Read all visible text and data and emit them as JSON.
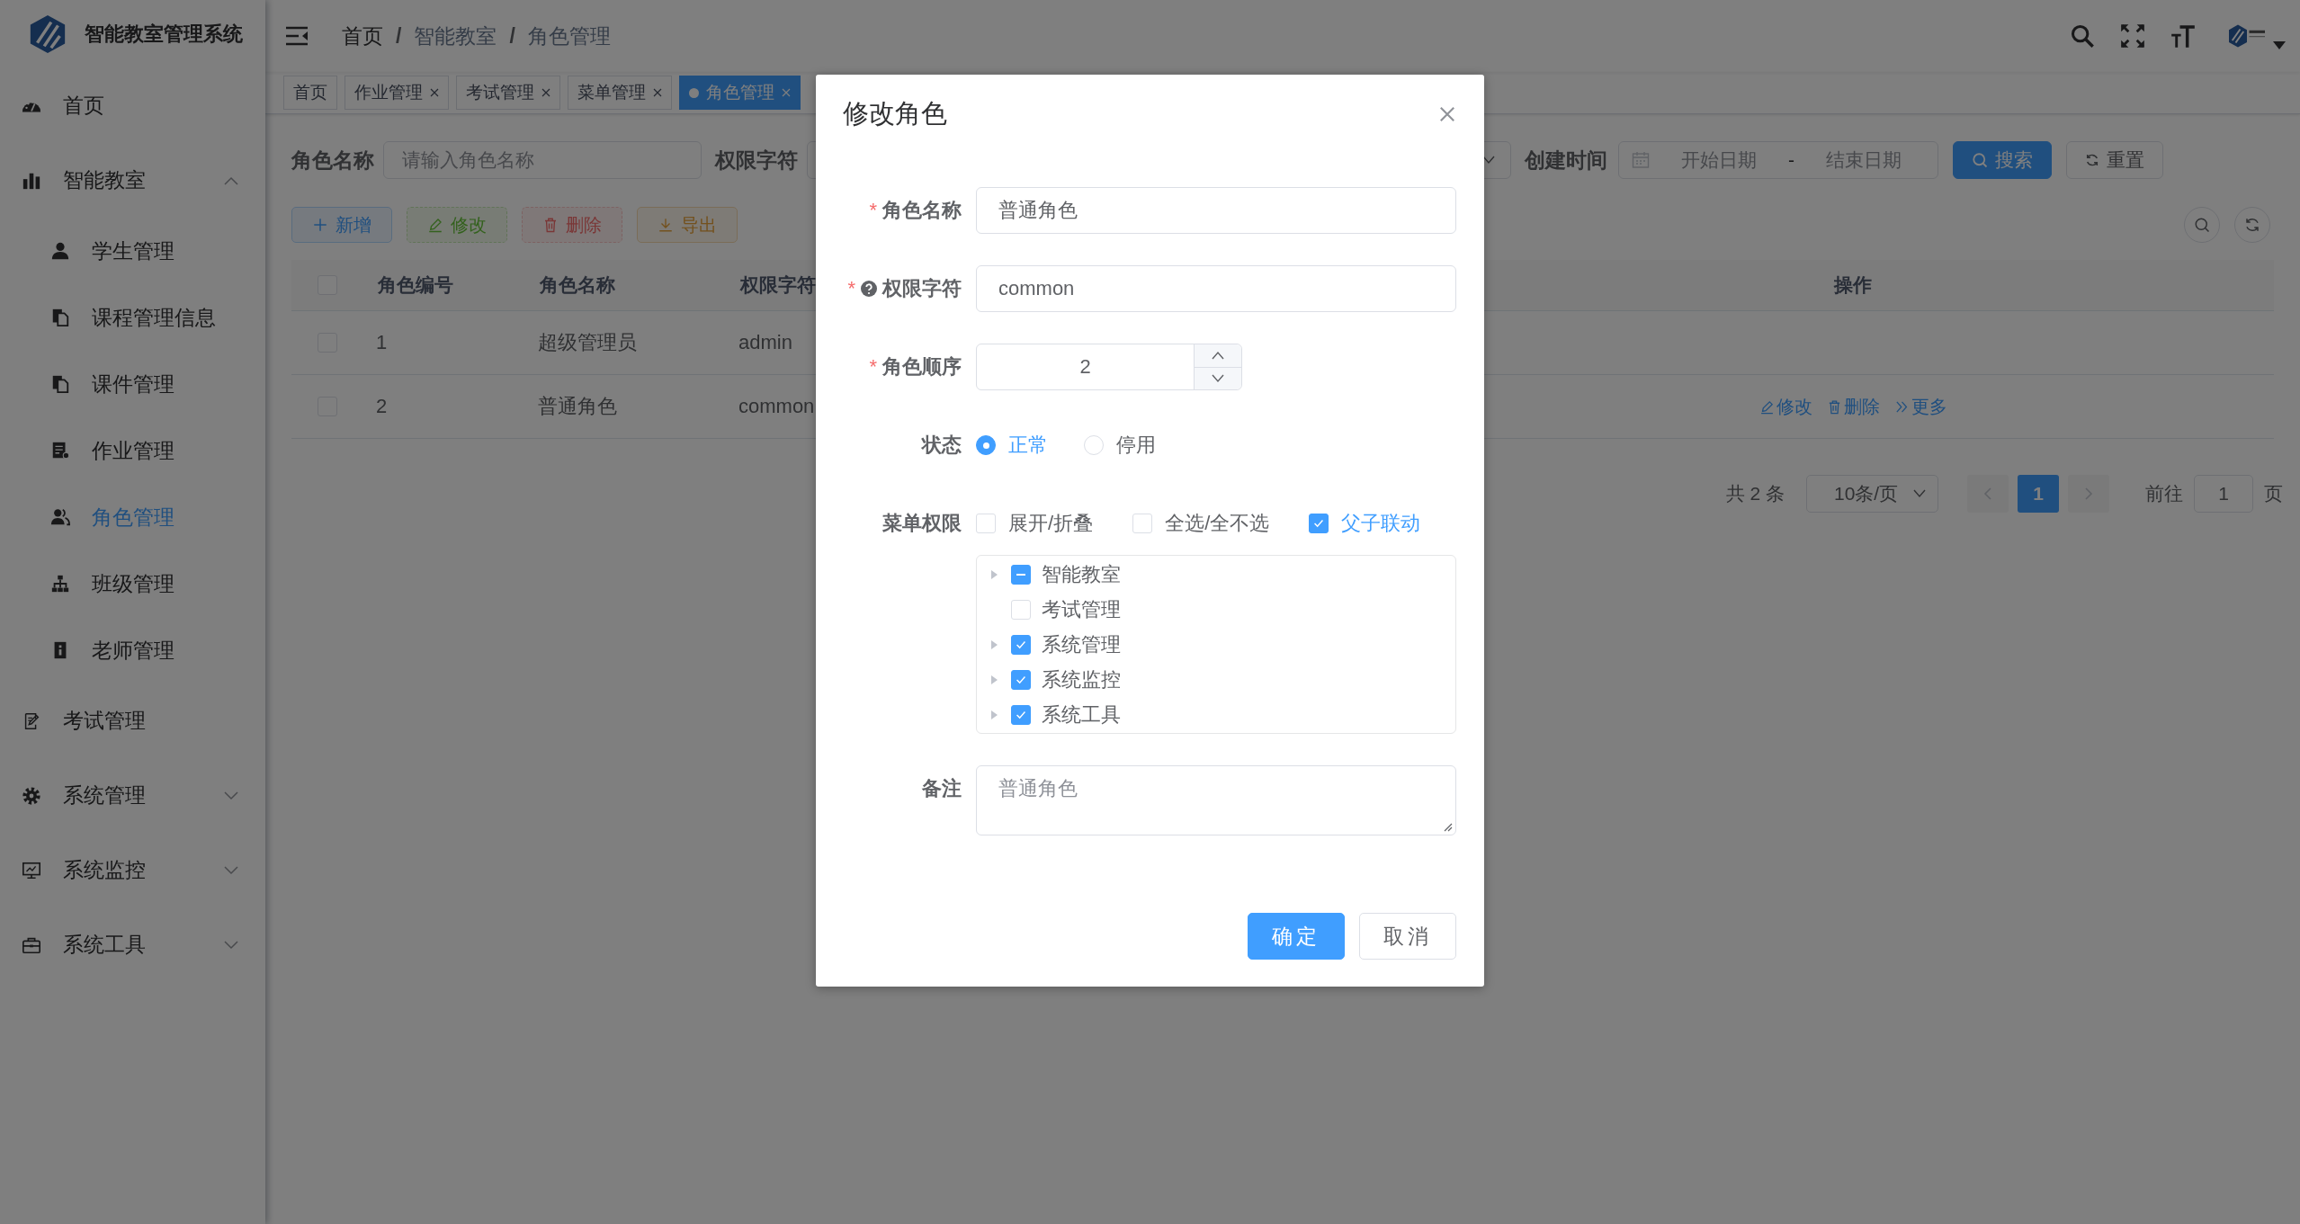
{
  "sidebar": {
    "logo_title": "智能教室管理系统",
    "items": [
      {
        "label": "首页",
        "selected": false
      },
      {
        "label": "智能教室",
        "selected": false,
        "expanded": true,
        "children": [
          {
            "label": "学生管理",
            "selected": false
          },
          {
            "label": "课程管理信息",
            "selected": false
          },
          {
            "label": "课件管理",
            "selected": false
          },
          {
            "label": "作业管理",
            "selected": false
          },
          {
            "label": "角色管理",
            "selected": true
          },
          {
            "label": "班级管理",
            "selected": false
          },
          {
            "label": "老师管理",
            "selected": false
          }
        ]
      },
      {
        "label": "考试管理",
        "selected": false
      },
      {
        "label": "系统管理",
        "selected": false,
        "expanded": false
      },
      {
        "label": "系统监控",
        "selected": false,
        "expanded": false
      },
      {
        "label": "系统工具",
        "selected": false,
        "expanded": false
      }
    ]
  },
  "breadcrumb": [
    {
      "kind": "link",
      "text": "首页"
    },
    {
      "kind": "separator",
      "text": "/"
    },
    {
      "kind": "item",
      "text": "智能教室"
    },
    {
      "kind": "separator",
      "text": "/"
    },
    {
      "kind": "item",
      "text": "角色管理"
    }
  ],
  "tags": [
    {
      "label": "首页",
      "selected": false,
      "closable": false
    },
    {
      "label": "作业管理",
      "selected": false,
      "closable": true
    },
    {
      "label": "考试管理",
      "selected": false,
      "closable": true
    },
    {
      "label": "菜单管理",
      "selected": false,
      "closable": true
    },
    {
      "label": "角色管理",
      "selected": true,
      "closable": true
    }
  ],
  "search": {
    "role_name_label": "角色名称",
    "role_name_placeholder": "请输入角色名称",
    "role_key_label": "权限字符",
    "created_label": "创建时间",
    "start_placeholder": "开始日期",
    "separator": "-",
    "end_placeholder": "结束日期",
    "search_button": "搜索",
    "reset_button": "重置"
  },
  "toolbar": [
    {
      "label": "新增",
      "kind": "primary",
      "disabled": false
    },
    {
      "label": "修改",
      "kind": "success",
      "disabled": true
    },
    {
      "label": "删除",
      "kind": "danger",
      "disabled": true
    },
    {
      "label": "导出",
      "kind": "warning",
      "disabled": false
    }
  ],
  "table": {
    "header_checked": false,
    "columns": [
      "角色编号",
      "角色名称",
      "权限字符",
      "操作"
    ],
    "rows": [
      {
        "checked": false,
        "cells": [
          "1",
          "超级管理员",
          "admin"
        ],
        "actions": []
      },
      {
        "checked": false,
        "cells": [
          "2",
          "普通角色",
          "common"
        ],
        "actions": [
          {
            "label": "修改",
            "kind": "edit"
          },
          {
            "label": "删除",
            "kind": "delete"
          },
          {
            "label": "更多",
            "kind": "more"
          }
        ]
      }
    ]
  },
  "pagination": {
    "total": "共 2 条",
    "page_size": "10条/页",
    "pages": [
      {
        "label": "1",
        "selected": true
      }
    ],
    "goto_label": "前往",
    "goto_value": "1",
    "page_suffix": "页"
  },
  "dialog": {
    "title": "修改角色",
    "fields": [
      {
        "kind": "text",
        "label": "角色名称",
        "required_mark": "*",
        "value": "普通角色"
      },
      {
        "kind": "text",
        "label": "权限字符",
        "required_mark": "*",
        "help": true,
        "value": "common"
      },
      {
        "kind": "number",
        "label": "角色顺序",
        "required_mark": "*",
        "value": "2"
      },
      {
        "kind": "radio",
        "label": "状态",
        "options": [
          {
            "label": "正常",
            "selected": true
          },
          {
            "label": "停用",
            "selected": false
          }
        ]
      },
      {
        "kind": "tree",
        "label": "菜单权限",
        "options": [
          {
            "label": "展开/折叠",
            "checked": false
          },
          {
            "label": "全选/全不选",
            "checked": false
          },
          {
            "label": "父子联动",
            "checked": true
          }
        ],
        "tree": [
          {
            "label": "智能教室",
            "indeterminate": true,
            "expandable": true
          },
          {
            "label": "考试管理",
            "checked": false,
            "expandable": false
          },
          {
            "label": "系统管理",
            "checked": true,
            "expandable": true
          },
          {
            "label": "系统监控",
            "checked": true,
            "expandable": true
          },
          {
            "label": "系统工具",
            "checked": true,
            "expandable": true
          }
        ]
      },
      {
        "kind": "textarea",
        "label": "备注",
        "placeholder": "普通角色"
      }
    ],
    "buttons": [
      {
        "label": "确定",
        "kind": "primary"
      },
      {
        "label": "取消",
        "kind": "default"
      }
    ]
  }
}
